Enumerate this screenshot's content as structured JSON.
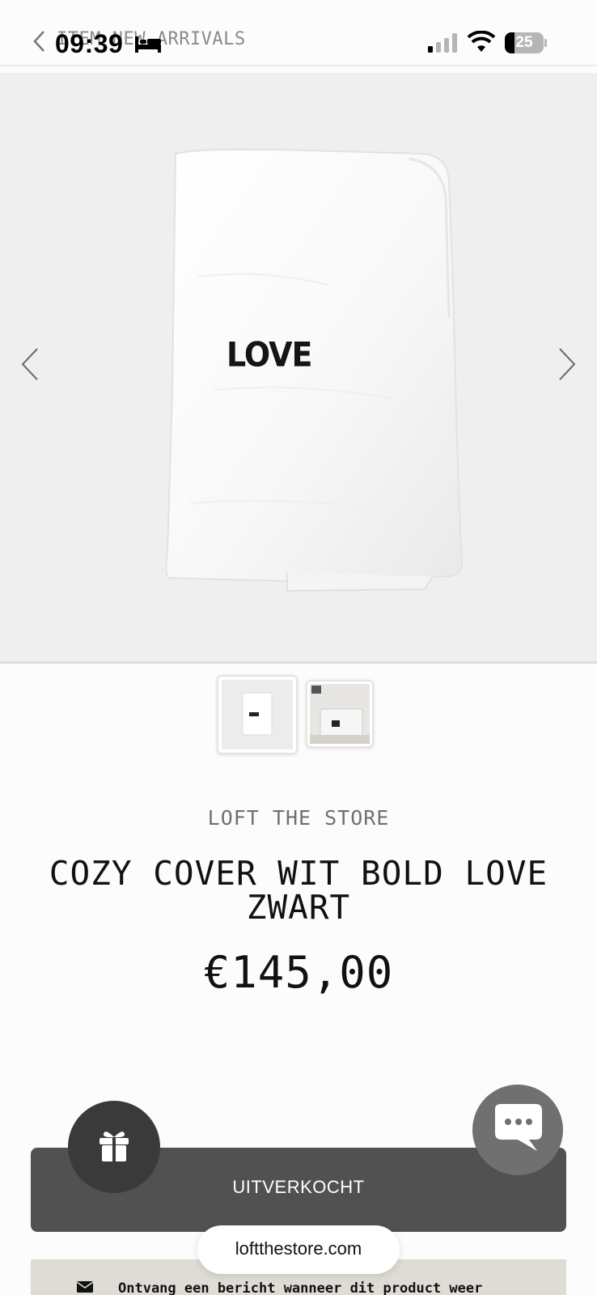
{
  "status_bar": {
    "time": "09:39",
    "battery_level": "25",
    "battery_fraction": 0.25
  },
  "header": {
    "breadcrumb": "ITEM NEW ARRIVALS"
  },
  "hero": {
    "print_text": "LOVE"
  },
  "product": {
    "vendor": "LOFT THE STORE",
    "title": "COZY COVER WIT BOLD LOVE ZWART",
    "price": "€145,00"
  },
  "buttons": {
    "soldout_label": "UITVERKOCHT"
  },
  "browser": {
    "url": "loftthestore.com"
  },
  "notify": {
    "text": "Ontvang een bericht wanneer dit product weer"
  },
  "colors": {
    "button_dark": "#515151",
    "gift_button": "#3a3a3a",
    "chat_button": "#707070",
    "notify_bg": "#dfdcd6"
  }
}
